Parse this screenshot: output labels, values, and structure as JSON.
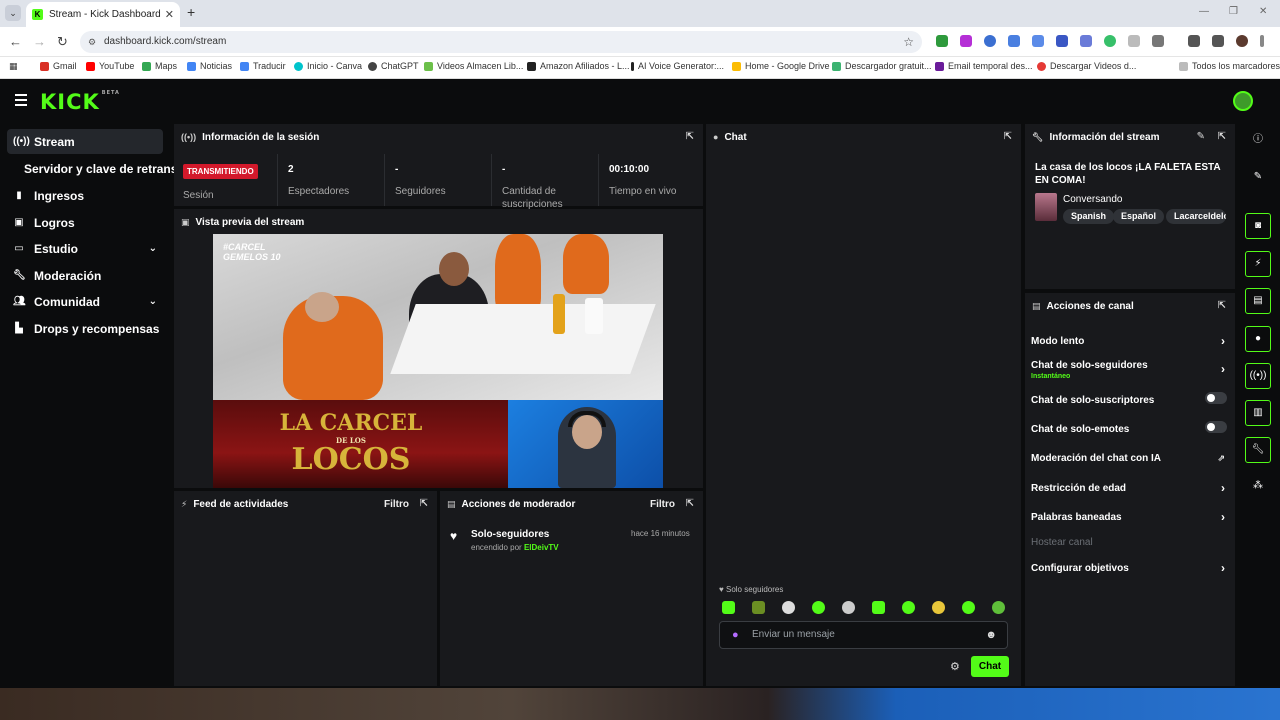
{
  "browser": {
    "tab_title": "Stream - Kick Dashboard",
    "url": "dashboard.kick.com/stream",
    "bookmarks": [
      "Gmail",
      "YouTube",
      "Maps",
      "Noticias",
      "Traducir",
      "Inicio - Canva",
      "ChatGPT",
      "Videos Almacen Lib...",
      "Amazon Afiliados - L...",
      "AI Voice Generator:...",
      "Home - Google Drive",
      "Descargador gratuit...",
      "Email temporal des...",
      "Descargar Videos d...",
      "Todos los marcadores"
    ]
  },
  "header": {
    "logo": "KICK",
    "logo_tag": "BETA"
  },
  "sidebar": {
    "items": [
      {
        "label": "Stream",
        "icon": "broadcast-icon"
      },
      {
        "label": "Servidor y clave de retransm",
        "icon": ""
      },
      {
        "label": "Ingresos",
        "icon": "chart-icon"
      },
      {
        "label": "Logros",
        "icon": "trophy-icon"
      },
      {
        "label": "Estudio",
        "icon": "studio-icon"
      },
      {
        "label": "Moderación",
        "icon": "wrench-icon"
      },
      {
        "label": "Comunidad",
        "icon": "people-icon"
      },
      {
        "label": "Drops y recompensas",
        "icon": "drops-icon"
      }
    ]
  },
  "session": {
    "title": "Información de la sesión",
    "status_badge": "TRANSMITIENDO",
    "status_label": "Sesión",
    "viewers_value": "2",
    "viewers_label": "Espectadores",
    "followers_value": "-",
    "followers_label": "Seguidores",
    "subs_value": "-",
    "subs_label": "Cantidad de suscripciones",
    "uptime_value": "00:10:00",
    "uptime_label": "Tiempo en vivo"
  },
  "preview": {
    "title": "Vista previa del stream",
    "hashtag": "#CARCEL GEMELOS 10",
    "show_l1": "LA CARCEL",
    "show_l2": "DE LOS",
    "show_l3": "LOCOS"
  },
  "activity": {
    "title": "Feed de actividades",
    "filter": "Filtro"
  },
  "mod_actions": {
    "title": "Acciones de moderador",
    "filter": "Filtro",
    "entry_title": "Solo-seguidores",
    "entry_time": "hace 16 minutos",
    "entry_sub": "encendido por",
    "entry_user": "ElDeivTV"
  },
  "chat": {
    "title": "Chat",
    "mode_label": "Solo seguidores",
    "placeholder": "Enviar un mensaje",
    "send_label": "Chat"
  },
  "stream_info": {
    "title": "Información del stream",
    "stream_title": "La casa de los locos ¡LA FALETA ESTA EN COMA!",
    "category": "Conversando",
    "tags": [
      "Spanish",
      "Español",
      "Lacarceldelo"
    ]
  },
  "channel_actions": {
    "title": "Acciones de canal",
    "slow_mode": "Modo lento",
    "followers_only": "Chat de solo-seguidores",
    "followers_only_sub": "Instantáneo",
    "subs_only": "Chat de solo-suscriptores",
    "emotes_only": "Chat de solo-emotes",
    "ai_mod": "Moderación del chat con IA",
    "age_restriction": "Restricción de edad",
    "banned_words": "Palabras baneadas",
    "host_channel": "Hostear canal",
    "goals": "Configurar objetivos"
  },
  "colors": {
    "accent": "#53fc18",
    "live": "#d3192b",
    "panel": "#18191c",
    "bg": "#0b0c0d"
  }
}
